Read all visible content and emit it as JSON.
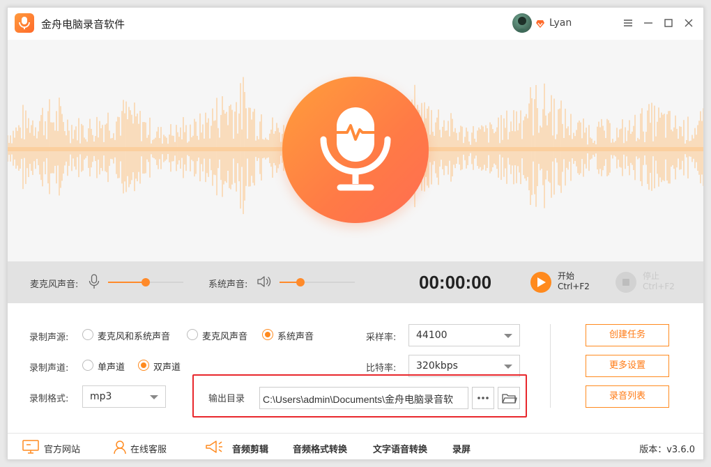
{
  "app": {
    "title": "金舟电脑录音软件"
  },
  "user": {
    "name": "Lyan"
  },
  "controls": {
    "mic_label": "麦克风声音:",
    "mic_volume": 0.5,
    "system_label": "系统声音:",
    "system_volume": 0.28,
    "timer": "00:00:00",
    "start_label": "开始",
    "start_shortcut": "Ctrl+F2",
    "stop_label": "停止",
    "stop_shortcut": "Ctrl+F2"
  },
  "settings": {
    "source_label": "录制声源:",
    "source_options": [
      "麦克风和系统声音",
      "麦克风声音",
      "系统声音"
    ],
    "source_selected": "系统声音",
    "channel_label": "录制声道:",
    "channel_options": [
      "单声道",
      "双声道"
    ],
    "channel_selected": "双声道",
    "format_label": "录制格式:",
    "format_value": "mp3",
    "samplerate_label": "采样率:",
    "samplerate_value": "44100",
    "bitrate_label": "比特率:",
    "bitrate_value": "320kbps",
    "output_label": "输出目录",
    "output_path": "C:\\Users\\admin\\Documents\\金舟电脑录音软"
  },
  "actions": {
    "create_task": "创建任务",
    "more_settings": "更多设置",
    "record_list": "录音列表"
  },
  "footer": {
    "website": "官方网站",
    "support": "在线客服",
    "audio_edit": "音频剪辑",
    "format_convert": "音频格式转换",
    "tts": "文字语音转换",
    "screen_record": "录屏",
    "version": "版本：v3.6.0"
  },
  "colors": {
    "accent": "#ff8a1e",
    "wave": "#fbcf9e",
    "highlight_box": "#e8272c"
  }
}
